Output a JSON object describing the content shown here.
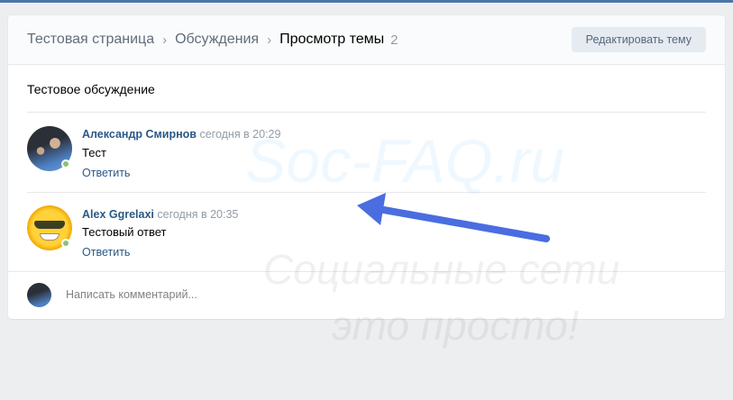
{
  "breadcrumb": [
    "Тестовая страница",
    "Обсуждения",
    "Просмотр темы"
  ],
  "count": "2",
  "edit_button": "Редактировать тему",
  "topic_title": "Тестовое обсуждение",
  "comments": [
    {
      "author": "Александр Смирнов",
      "time": "сегодня в 20:29",
      "text": "Тест",
      "reply": "Ответить"
    },
    {
      "author": "Alex Ggrelaxi",
      "time": "сегодня в 20:35",
      "text": "Тестовый ответ",
      "reply": "Ответить"
    }
  ],
  "compose_placeholder": "Написать комментарий...",
  "watermark": {
    "line1": "Soc-FAQ.ru",
    "line2": "Социальные сети",
    "line3": "это просто!"
  },
  "colors": {
    "accent": "#2a5885",
    "online": "#8ac176",
    "arrow": "#4a6de0"
  }
}
